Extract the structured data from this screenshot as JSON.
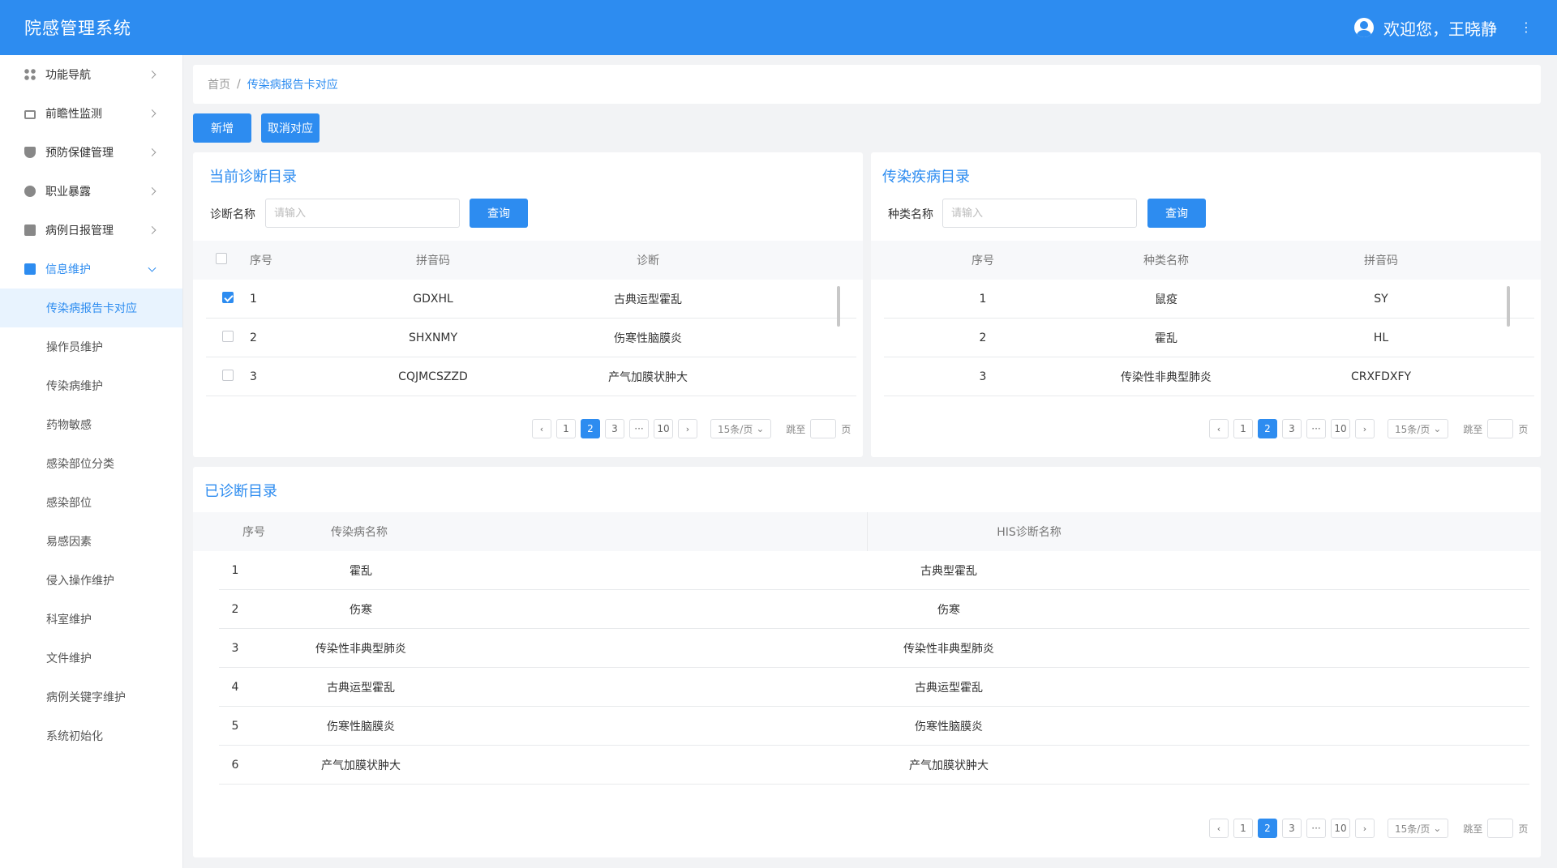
{
  "header": {
    "app_title": "院感管理系统",
    "welcome": "欢迎您，王晓静",
    "more": "⋮"
  },
  "sidebar": {
    "menus": [
      {
        "label": "功能导航",
        "icon": "grid-icon"
      },
      {
        "label": "前瞻性监测",
        "icon": "monitor-icon"
      },
      {
        "label": "预防保健管理",
        "icon": "shield-icon"
      },
      {
        "label": "职业暴露",
        "icon": "hazard-icon"
      },
      {
        "label": "病例日报管理",
        "icon": "document-icon"
      },
      {
        "label": "信息维护",
        "icon": "info-icon"
      }
    ],
    "submenu": [
      "传染病报告卡对应",
      "操作员维护",
      "传染病维护",
      "药物敏感",
      "感染部位分类",
      "感染部位",
      "易感因素",
      "侵入操作维护",
      "科室维护",
      "文件维护",
      "病例关键字维护",
      "系统初始化"
    ]
  },
  "breadcrumb": {
    "home": "首页",
    "separator": "/",
    "current": "传染病报告卡对应"
  },
  "toolbar": {
    "add_label": "新增",
    "cancel_label": "取消对应"
  },
  "diag_panel": {
    "title": "当前诊断目录",
    "search_label": "诊断名称",
    "placeholder": "请输入",
    "query_label": "查询",
    "columns": [
      "序号",
      "拼音码",
      "诊断"
    ],
    "rows": [
      {
        "no": "1",
        "code": "GDXHL",
        "name": "古典运型霍乱",
        "checked": true
      },
      {
        "no": "2",
        "code": "SHXNMY",
        "name": "伤寒性脑膜炎",
        "checked": false
      },
      {
        "no": "3",
        "code": "CQJMCSZZD",
        "name": "产气加膜状肿大",
        "checked": false
      }
    ]
  },
  "disease_panel": {
    "title": "传染疾病目录",
    "search_label": "种类名称",
    "placeholder": "请输入",
    "query_label": "查询",
    "columns": [
      "序号",
      "种类名称",
      "拼音码"
    ],
    "rows": [
      {
        "no": "1",
        "name": "鼠疫",
        "code": "SY"
      },
      {
        "no": "2",
        "name": "霍乱",
        "code": "HL"
      },
      {
        "no": "3",
        "name": "传染性非典型肺炎",
        "code": "CRXFDXFY"
      }
    ]
  },
  "done_panel": {
    "title": "已诊断目录",
    "columns": [
      "序号",
      "传染病名称",
      "HIS诊断名称"
    ],
    "rows": [
      {
        "no": "1",
        "disease": "霍乱",
        "his": "古典型霍乱"
      },
      {
        "no": "2",
        "disease": "伤寒",
        "his": "伤寒"
      },
      {
        "no": "3",
        "disease": "传染性非典型肺炎",
        "his": "传染性非典型肺炎"
      },
      {
        "no": "4",
        "disease": "古典运型霍乱",
        "his": "古典运型霍乱"
      },
      {
        "no": "5",
        "disease": "伤寒性脑膜炎",
        "his": "伤寒性脑膜炎"
      },
      {
        "no": "6",
        "disease": "产气加膜状肿大",
        "his": "产气加膜状肿大"
      }
    ]
  },
  "pagination": {
    "prev": "‹",
    "next": "›",
    "pages": [
      "1",
      "2",
      "3",
      "···",
      "10"
    ],
    "current": "2",
    "page_size": "15条/页",
    "jump_label": "跳至",
    "page_label": "页"
  },
  "colors": {
    "primary": "#2d8cf0",
    "active_bg": "#e8f3fe"
  }
}
